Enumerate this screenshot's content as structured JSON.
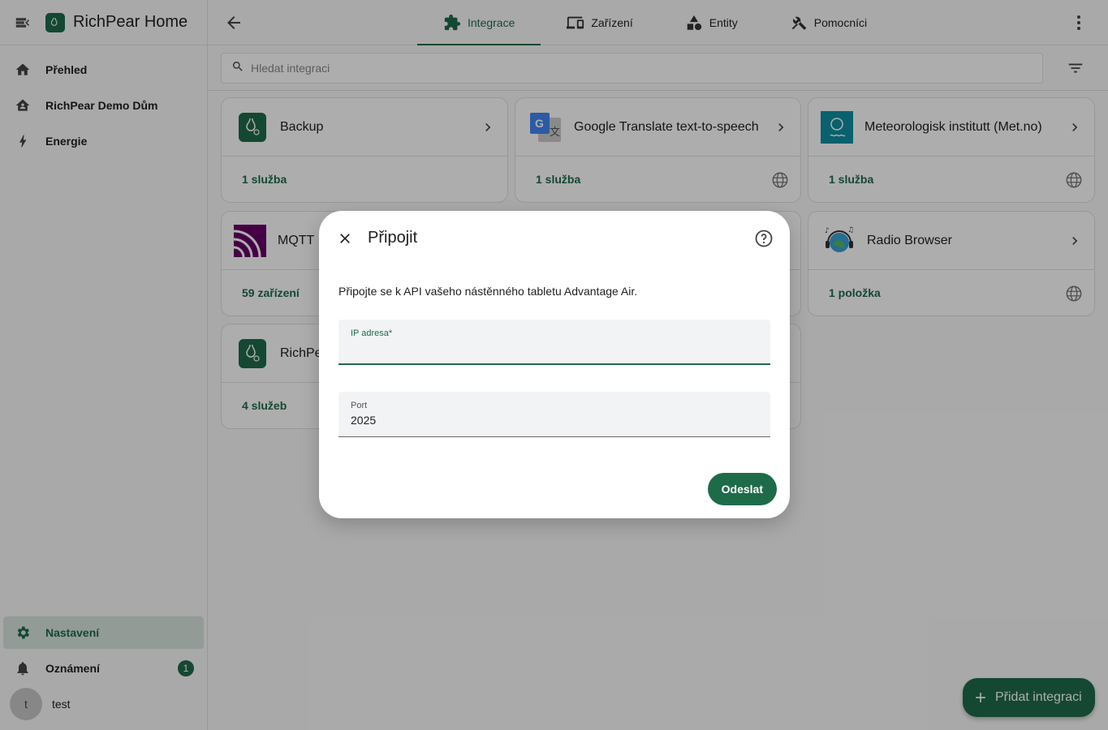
{
  "app": {
    "title": "RichPear Home"
  },
  "sidebar": {
    "items": [
      {
        "label": "Přehled",
        "icon": "home-icon"
      },
      {
        "label": "RichPear Demo Dům",
        "icon": "home-account-icon"
      },
      {
        "label": "Energie",
        "icon": "lightning-icon"
      }
    ],
    "bottom": {
      "settings": "Nastavení",
      "notifications": "Oznámení",
      "notifications_count": "1",
      "user_initial": "t",
      "user_name": "test"
    }
  },
  "tabs": [
    {
      "label": "Integrace",
      "icon": "puzzle-icon",
      "active": true
    },
    {
      "label": "Zařízení",
      "icon": "devices-icon"
    },
    {
      "label": "Entity",
      "icon": "shapes-icon"
    },
    {
      "label": "Pomocníci",
      "icon": "tools-icon"
    }
  ],
  "search": {
    "placeholder": "Hledat integraci"
  },
  "cards": [
    {
      "name": "Backup",
      "link": "1 služba"
    },
    {
      "name": "Google Translate text-to-speech",
      "link": "1 služba"
    },
    {
      "name": "Meteorologisk institutt (Met.no)",
      "link": "1 služba"
    },
    {
      "name": "MQTT",
      "link": "59 zařízení"
    },
    {
      "name": "Radio Browser",
      "link": "1 položka"
    },
    {
      "name": "RichPe",
      "link": "4 služeb"
    }
  ],
  "dialog": {
    "title": "Připojit",
    "description": "Připojte se k API vašeho nástěnného tabletu Advantage Air.",
    "ip_label": "IP adresa*",
    "ip_value": "",
    "port_label": "Port",
    "port_value": "2025",
    "submit_label": "Odeslat"
  },
  "fab": {
    "label": "Přidat integraci"
  },
  "colors": {
    "accent": "#1e6b4a"
  }
}
